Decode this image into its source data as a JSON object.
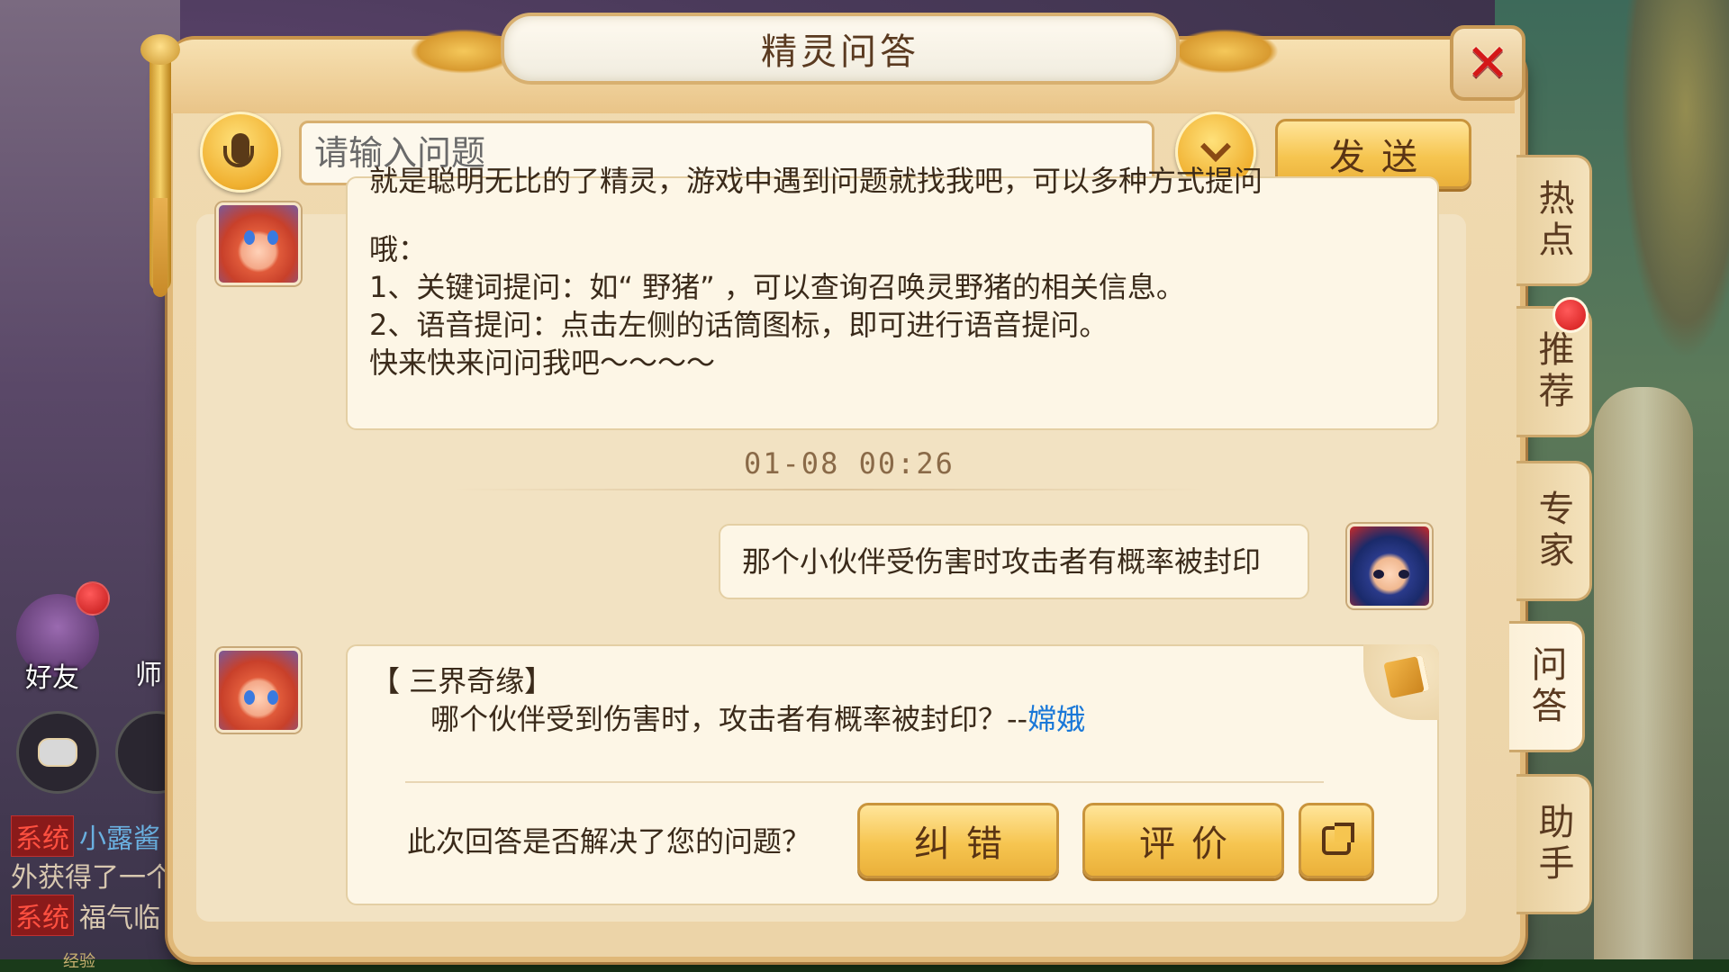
{
  "dialog": {
    "title": "精灵问答",
    "close_symbol": "✕"
  },
  "search": {
    "placeholder": "请输入问题",
    "send_label": "发送"
  },
  "intro_message": {
    "cut_line": "就是聪明无比的了精灵，游戏中遇到问题就找我吧，可以多种方式提问",
    "lines": [
      "哦：",
      "1、关键词提问：如“ 野猪” ，可以查询召唤灵野猪的相关信息。",
      "2、语音提问：点击左侧的话筒图标，即可进行语音提问。",
      "快来快来问问我吧～～～～"
    ]
  },
  "timestamp": "01-08 00:26",
  "user_message": "那个小伙伴受伤害时攻击者有概率被封印",
  "answer": {
    "heading": "【 三界奇缘】",
    "body": "哪个伙伴受到伤害时，攻击者有概率被封印？--",
    "link": "嫦娥",
    "feedback_question": "此次回答是否解决了您的问题？",
    "fix_label": "纠错",
    "rate_label": "评价"
  },
  "side_tabs": [
    "热点",
    "推荐",
    "专家",
    "问答",
    "助手"
  ],
  "hud": {
    "friend_label": "好友",
    "master_label": "师",
    "chat_lines": [
      {
        "tag": "系统",
        "text": "小露酱"
      },
      {
        "tag": "",
        "text": "外获得了一个"
      },
      {
        "tag": "系统",
        "text": "福气临"
      }
    ],
    "bottom_label": "经验"
  },
  "colors": {
    "accent_gold": "#f6c550",
    "link_blue": "#1a78d8",
    "close_red": "#d41818",
    "notify_red": "#d01818"
  }
}
